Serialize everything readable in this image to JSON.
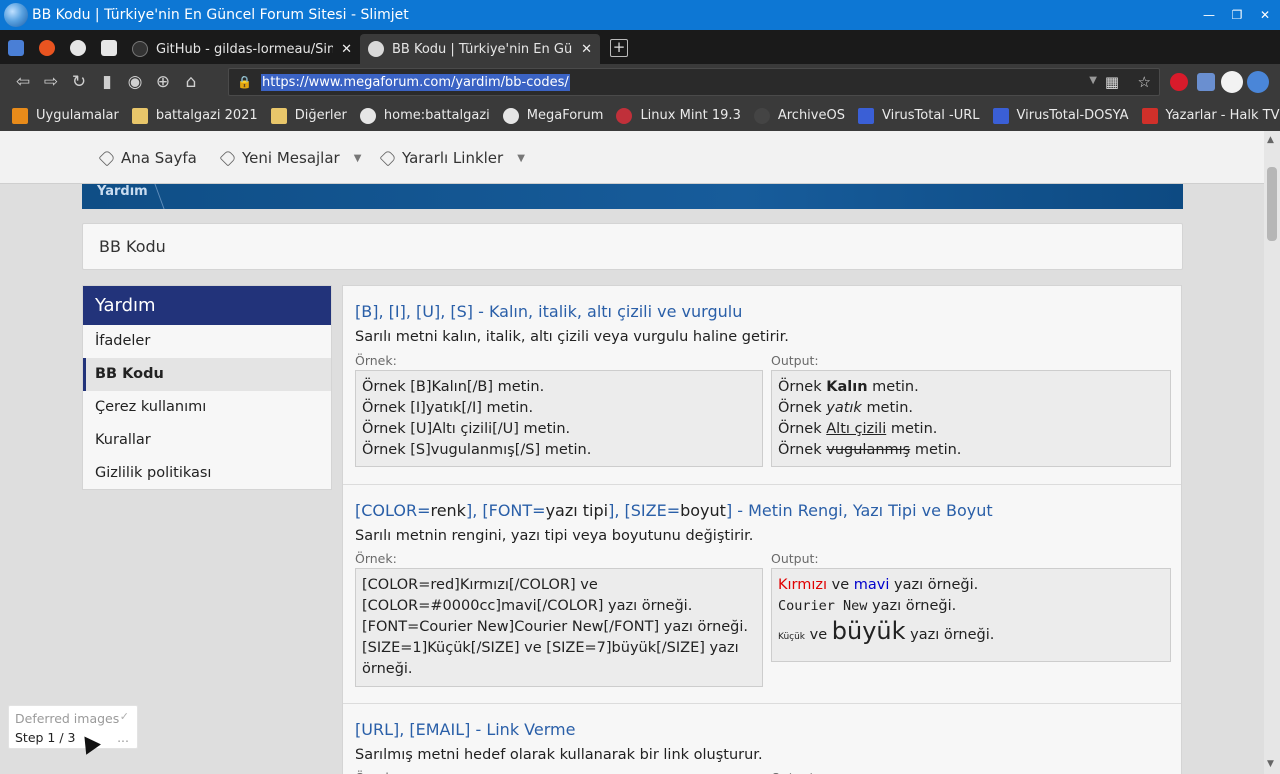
{
  "window": {
    "title": "BB Kodu | Türkiye'nin En Güncel Forum Sitesi - Slimjet"
  },
  "tabs": [
    {
      "label": "GitHub - gildas-lormeau/Single",
      "favicon_color": "#333333"
    },
    {
      "label": "BB Kodu | Türkiye'nin En Güncel",
      "favicon_color": "#d9d9d9"
    }
  ],
  "pinned_tabs": [
    {
      "icon": "translate-icon",
      "color": "#4a7fd6"
    },
    {
      "icon": "ubuntu-icon",
      "color": "#e95420"
    },
    {
      "icon": "globe-icon",
      "color": "#e6e6e6"
    },
    {
      "icon": "puzzle-icon",
      "color": "#e6e6e6"
    }
  ],
  "address_bar": {
    "url": "https://www.megaforum.com/yardim/bb-codes/"
  },
  "bookmarks": [
    {
      "label": "Uygulamalar",
      "icon": "apps-grid-icon",
      "color": "#e88b1a"
    },
    {
      "label": "battalgazi 2021",
      "icon": "folder-icon",
      "color": "#e8c66a"
    },
    {
      "label": "Diğerler",
      "icon": "folder-icon",
      "color": "#e8c66a"
    },
    {
      "label": "home:battalgazi",
      "icon": "globe-icon",
      "color": "#e6e6e6"
    },
    {
      "label": "MegaForum",
      "icon": "globe-icon",
      "color": "#e6e6e6"
    },
    {
      "label": "Linux Mint 19.3",
      "icon": "mint-icon",
      "color": "#c0303a"
    },
    {
      "label": "ArchiveOS",
      "icon": "archive-icon",
      "color": "#444444"
    },
    {
      "label": "VirusTotal -URL",
      "icon": "virustotal-icon",
      "color": "#3a5fd6"
    },
    {
      "label": "VirusTotal-DOSYA",
      "icon": "virustotal-icon",
      "color": "#3a5fd6"
    },
    {
      "label": "Yazarlar - Halk TV",
      "icon": "halktv-icon",
      "color": "#d0302a"
    }
  ],
  "site_nav": [
    {
      "label": "Ana Sayfa",
      "has_caret": false
    },
    {
      "label": "Yeni Mesajlar",
      "has_caret": true
    },
    {
      "label": "Yararlı Linkler",
      "has_caret": true
    }
  ],
  "breadcrumb": "Yardım",
  "page_title": "BB Kodu",
  "sidebar": {
    "heading": "Yardım",
    "items": [
      {
        "label": "İfadeler",
        "active": false
      },
      {
        "label": "BB Kodu",
        "active": true
      },
      {
        "label": "Çerez kullanımı",
        "active": false
      },
      {
        "label": "Kurallar",
        "active": false
      },
      {
        "label": "Gizlilik politikası",
        "active": false
      }
    ]
  },
  "labels": {
    "example": "Örnek:",
    "output": "Output:"
  },
  "sections": [
    {
      "title": "[B], [I], [U], [S] - Kalın, italik, altı çizili ve vurgulu",
      "description": "Sarılı metni kalın, italik, altı çizili veya vurgulu haline getirir.",
      "example": [
        "Örnek [B]Kalın[/B] metin.",
        "Örnek [I]yatık[/I] metin.",
        "Örnek [U]Altı çizili[/U] metin.",
        "Örnek [S]vugulanmış[/S] metin."
      ],
      "output": {
        "prefix": "Örnek",
        "suffix": "metin.",
        "bold": "Kalın",
        "italic": "yatık",
        "underline": "Altı çizili",
        "strike": "vugulanmış"
      }
    },
    {
      "title_parts": [
        "[COLOR=",
        "renk",
        "], [FONT=",
        "yazı tipi",
        "], [SIZE=",
        "boyut",
        "] - Metin Rengi, Yazı Tipi ve Boyut"
      ],
      "description": "Sarılı metnin rengini, yazı tipi veya boyutunu değiştirir.",
      "example": [
        "[COLOR=red]Kırmızı[/COLOR] ve",
        "[COLOR=#0000cc]mavi[/COLOR] yazı örneği.",
        "[FONT=Courier New]Courier New[/FONT] yazı örneği.",
        "[SIZE=1]Küçük[/SIZE] ve [SIZE=7]büyük[/SIZE] yazı",
        "örneği."
      ],
      "output": {
        "red": "Kırmızı",
        "and": "ve",
        "blue": "mavi",
        "sample_suffix": "yazı örneği.",
        "courier": "Courier New",
        "small": "Küçük",
        "big": "büyük",
        "red_color": "#e00000",
        "blue_color": "#0000cc"
      }
    },
    {
      "title": "[URL], [EMAIL] - Link Verme",
      "description": "Sarılmış metni hedef olarak kullanarak bir link oluşturur."
    }
  ],
  "deferred_panel": {
    "title": "Deferred images",
    "step": "Step 1 / 3",
    "more": "..."
  }
}
